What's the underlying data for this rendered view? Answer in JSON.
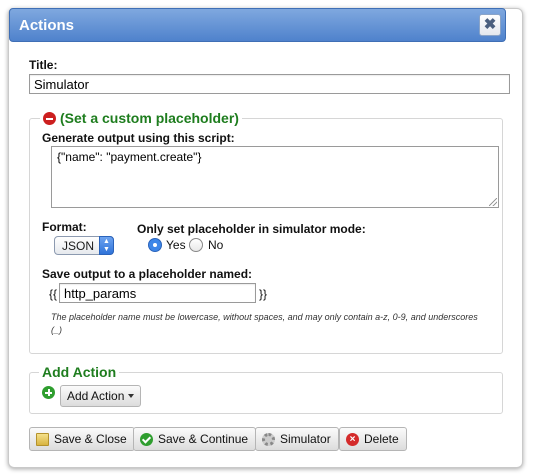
{
  "dialog": {
    "title": "Actions",
    "close_glyph": "✖"
  },
  "form": {
    "title_label": "Title:",
    "title_value": "Simulator"
  },
  "placeholder_section": {
    "legend": "(Set a custom placeholder)",
    "script_label": "Generate output using this script:",
    "script_value": "{\"name\": \"payment.create\"}",
    "format_label": "Format:",
    "format_selected": "JSON",
    "sim_mode_label": "Only set placeholder in simulator mode:",
    "sim_mode_options": [
      "Yes",
      "No"
    ],
    "sim_mode_selected": "Yes",
    "save_output_label": "Save output to a placeholder named:",
    "brace_open": "{{",
    "brace_close": "}}",
    "placeholder_name": "http_params",
    "help_text": "The placeholder name must be lowercase, without spaces, and may only contain a-z, 0-9, and underscores (_)"
  },
  "add_action_section": {
    "legend": "Add Action",
    "dropdown_label": "Add Action"
  },
  "footer": {
    "save_close": "Save & Close",
    "save_continue": "Save & Continue",
    "simulator": "Simulator",
    "delete": "Delete"
  },
  "icons": {
    "close": "close-icon",
    "remove": "minus-circle-icon",
    "add": "plus-circle-icon",
    "save_close": "folder-icon",
    "save_continue": "check-circle-icon",
    "simulator": "gear-icon",
    "delete": "x-circle-icon"
  },
  "colors": {
    "titlebar": "#5b8ed6",
    "legend_green": "#1e7d1e"
  }
}
